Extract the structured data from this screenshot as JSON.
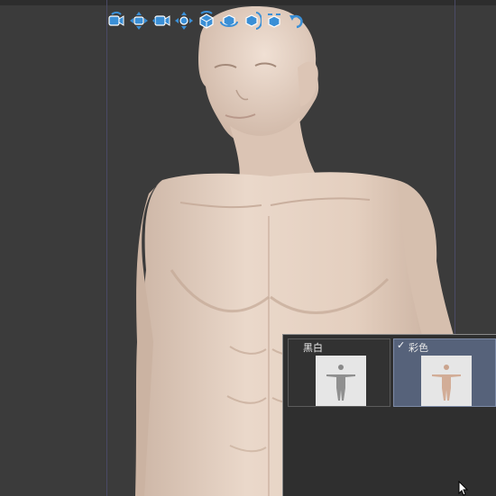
{
  "toolbar": {
    "tools": [
      {
        "icon": "rotate-camera-icon"
      },
      {
        "icon": "pan-camera-icon"
      },
      {
        "icon": "dolly-camera-icon"
      },
      {
        "icon": "move-model-icon"
      },
      {
        "icon": "rotate-model-icon"
      },
      {
        "icon": "rotate-horizontal-icon"
      },
      {
        "icon": "rotate-vertical-icon"
      },
      {
        "icon": "reset-view-icon"
      }
    ],
    "accent_color": "#3a8fd6"
  },
  "render_panel": {
    "options": [
      {
        "label": "黑白",
        "selected": false
      },
      {
        "label": "彩色",
        "selected": true
      }
    ],
    "check_glyph": "✓"
  },
  "colors": {
    "viewport_bg": "#3b3b3b",
    "skin": "#e7d3c4",
    "selected_bg": "#56627a"
  }
}
